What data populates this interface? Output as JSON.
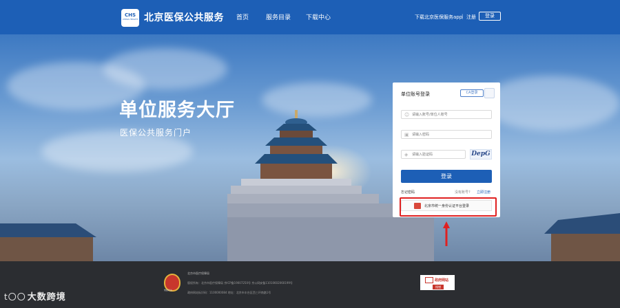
{
  "header": {
    "logo_text": "CHS",
    "logo_subtext": "CHINA HEALTH",
    "title": "北京医保公共服务",
    "nav": {
      "home": "首页",
      "directory": "服务目录",
      "download": "下载中心"
    },
    "app_link": "下载北京医保服务app",
    "separator": "|",
    "register": "注册",
    "login": "登录"
  },
  "hero": {
    "title": "单位服务大厅",
    "subtitle": "医保公共服务门户"
  },
  "login": {
    "title": "单位账号登录",
    "ca_tab": "CA登录",
    "account_placeholder": "请输入账号/单位人账号",
    "password_placeholder": "请输入密码",
    "code_placeholder": "请输入验证码",
    "captcha_text": "DepG",
    "submit": "登录",
    "forgot": "忘记密码",
    "no_account": "没有账号?",
    "register": "立即注册",
    "unified_login": "北京市统一身份认证平台登录"
  },
  "footer": {
    "emblem_caption": "党政机关",
    "line1": "北京市医疗保障局",
    "line2": "版权所有：北京市医疗保障局  京ICP备19007250号  京公网安备11010602060199号",
    "line3": "政府网站标识码：1100000084   地址：北京市丰台区西三环南路1号",
    "gov_badge_title": "政府网站",
    "gov_badge_sub": "找错"
  },
  "watermark": {
    "logo": "t〇〇",
    "text": "大数跨境"
  },
  "colors": {
    "brand_blue": "#1d5fb6",
    "annotation_red": "#e02020",
    "footer_bg": "#2b2d31"
  }
}
